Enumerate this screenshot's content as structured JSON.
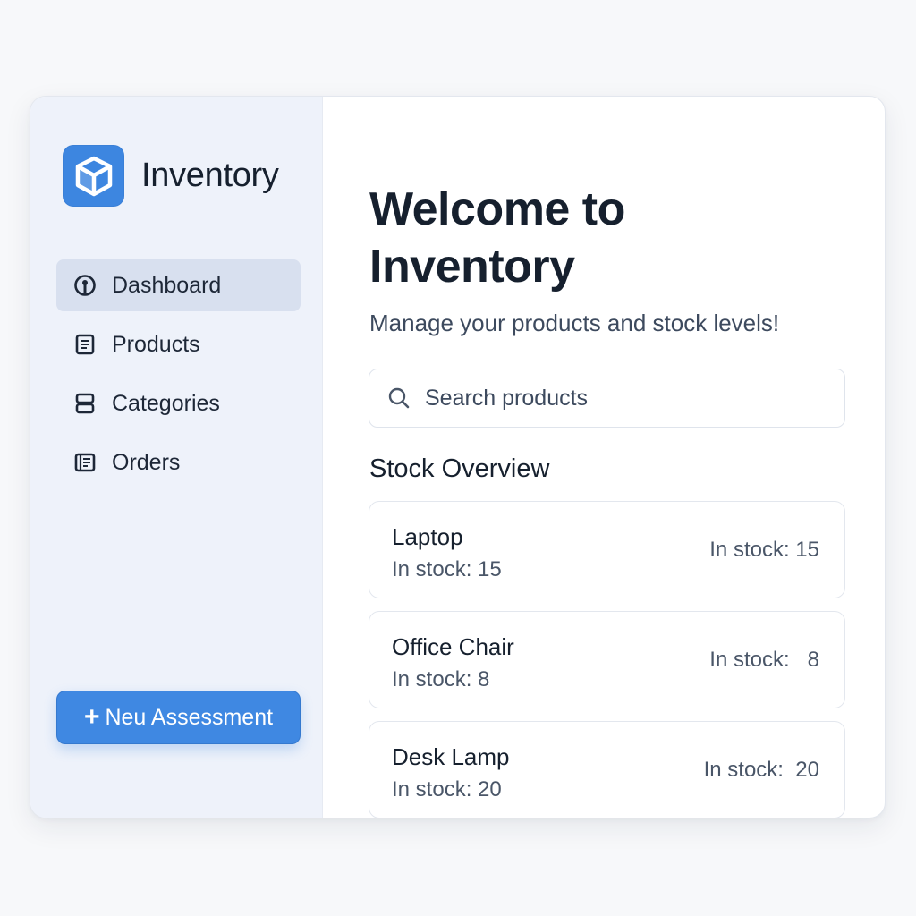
{
  "app": {
    "name": "Inventory",
    "accent_color": "#3d86e0",
    "logo_icon": "box-icon"
  },
  "sidebar": {
    "items": [
      {
        "label": "Dashboard",
        "icon": "dashboard-icon",
        "active": true
      },
      {
        "label": "Products",
        "icon": "document-icon",
        "active": false
      },
      {
        "label": "Categories",
        "icon": "categories-icon",
        "active": false
      },
      {
        "label": "Orders",
        "icon": "orders-icon",
        "active": false
      }
    ],
    "new_button_label": "Neu Assessment",
    "new_button_icon": "plus-icon"
  },
  "main": {
    "title": "Welcome to Inventory",
    "subtitle": "Manage your products and stock levels!",
    "search_placeholder": "Search products",
    "section_title": "Stock Overview",
    "products": [
      {
        "name": "Laptop",
        "stock_text": "In stock: 15",
        "right_text": "In stock: 15"
      },
      {
        "name": "Office Chair",
        "stock_text": "In stock: 8",
        "right_text": "In stock:   8"
      },
      {
        "name": "Desk Lamp",
        "stock_text": "In stock: 20",
        "right_text": "In stock:  20"
      }
    ]
  }
}
